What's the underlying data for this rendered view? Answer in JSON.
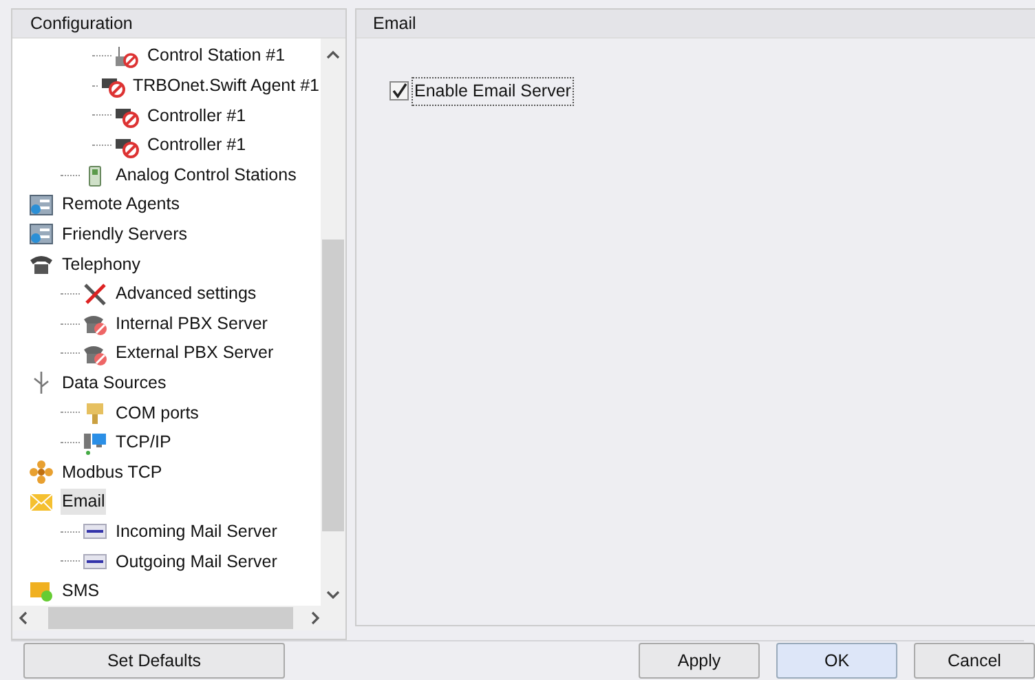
{
  "left_panel": {
    "title": "Configuration"
  },
  "tree": [
    {
      "children": [
        {
          "children": [
            {
              "label": "Control Station #1",
              "kind": "station",
              "selected": false
            },
            {
              "label": "TRBOnet.Swift Agent #1",
              "kind": "agent",
              "selected": false
            },
            {
              "label": "Controller #1",
              "kind": "controller",
              "selected": false
            },
            {
              "label": "Controller #1",
              "kind": "controller",
              "selected": false
            }
          ]
        },
        {
          "label": "Analog Control Stations",
          "kind": "handset",
          "selected": false
        }
      ]
    },
    {
      "label": "Remote Agents",
      "kind": "server",
      "selected": false
    },
    {
      "label": "Friendly Servers",
      "kind": "server",
      "selected": false
    },
    {
      "label": "Telephony",
      "kind": "phone",
      "selected": false,
      "children": [
        {
          "label": "Advanced settings",
          "kind": "tools",
          "selected": false
        },
        {
          "label": "Internal PBX Server",
          "kind": "pbx",
          "selected": false
        },
        {
          "label": "External PBX Server",
          "kind": "pbx",
          "selected": false
        }
      ]
    },
    {
      "label": "Data Sources",
      "kind": "usb",
      "selected": false,
      "children": [
        {
          "label": "COM ports",
          "kind": "port",
          "selected": false
        },
        {
          "label": "TCP/IP",
          "kind": "network",
          "selected": false
        }
      ]
    },
    {
      "label": "Modbus TCP",
      "kind": "modbus",
      "selected": false
    },
    {
      "label": "Email",
      "kind": "email",
      "selected": true,
      "children": [
        {
          "label": "Incoming Mail Server",
          "kind": "mailserver",
          "selected": false
        },
        {
          "label": "Outgoing Mail Server",
          "kind": "mailserver",
          "selected": false
        }
      ]
    },
    {
      "label": "SMS",
      "kind": "sms",
      "selected": false
    }
  ],
  "set_defaults_button": "Set Defaults",
  "right_panel": {
    "title": "Email",
    "enable_checkbox": {
      "label": "Enable Email Server",
      "checked": true
    }
  },
  "buttons": [
    {
      "label": "Apply",
      "kind": "normal"
    },
    {
      "label": "OK",
      "kind": "default"
    },
    {
      "label": "Cancel",
      "kind": "normal"
    }
  ]
}
